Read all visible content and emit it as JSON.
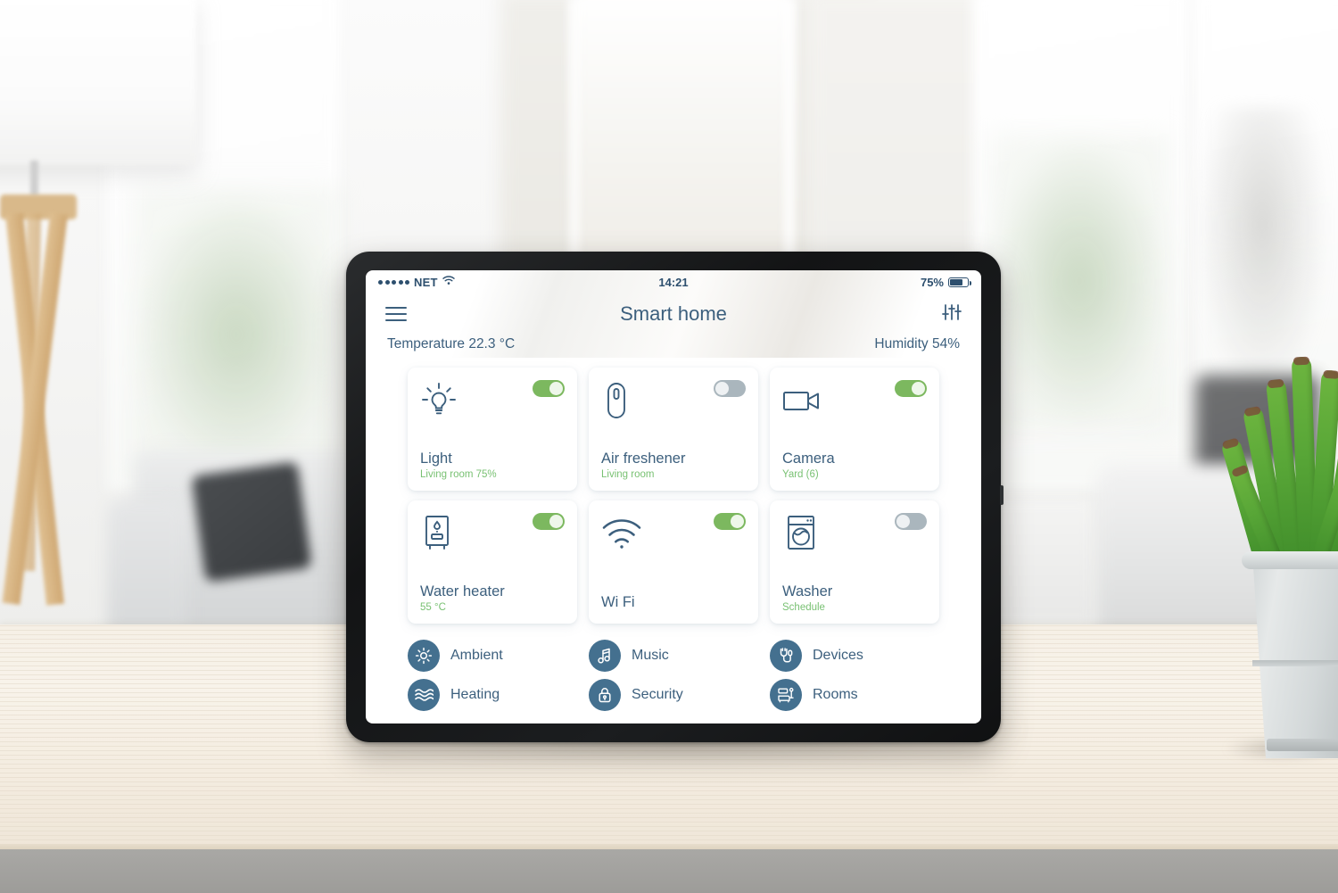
{
  "status_bar": {
    "carrier": "NET",
    "signal_dots": 5,
    "wifi_icon": "wifi-icon",
    "time": "14:21",
    "battery_percent": "75%",
    "battery_level": 75
  },
  "app_bar": {
    "menu_icon": "hamburger-menu-icon",
    "title": "Smart home",
    "settings_icon": "equalizer-sliders-icon"
  },
  "environment": {
    "temperature": "Temperature 22.3 °C",
    "humidity": "Humidity 54%"
  },
  "cards": [
    {
      "icon": "lightbulb-icon",
      "title": "Light",
      "subtitle": "Living room 75%",
      "toggle": "on"
    },
    {
      "icon": "air-freshener-icon",
      "title": "Air freshener",
      "subtitle": "Living room",
      "toggle": "off"
    },
    {
      "icon": "video-camera-icon",
      "title": "Camera",
      "subtitle": "Yard (6)",
      "toggle": "on"
    },
    {
      "icon": "water-heater-icon",
      "title": "Water heater",
      "subtitle": "55 °C",
      "toggle": "on"
    },
    {
      "icon": "wifi-icon",
      "title": "Wi Fi",
      "subtitle": "",
      "toggle": "on"
    },
    {
      "icon": "washing-machine-icon",
      "title": "Washer",
      "subtitle": "Schedule",
      "toggle": "off"
    }
  ],
  "nav_items": [
    {
      "icon": "sun-icon",
      "label": "Ambient"
    },
    {
      "icon": "music-note-icon",
      "label": "Music"
    },
    {
      "icon": "plug-icon",
      "label": "Devices"
    },
    {
      "icon": "waves-icon",
      "label": "Heating"
    },
    {
      "icon": "lock-icon",
      "label": "Security"
    },
    {
      "icon": "furniture-icon",
      "label": "Rooms"
    }
  ],
  "colors": {
    "accent_blue": "#3c5f7d",
    "nav_circle": "#44708f",
    "toggle_on": "#7cb85f",
    "toggle_off": "#aab6bd",
    "subtitle_green": "#79c173",
    "card_background": "#ffffff"
  }
}
